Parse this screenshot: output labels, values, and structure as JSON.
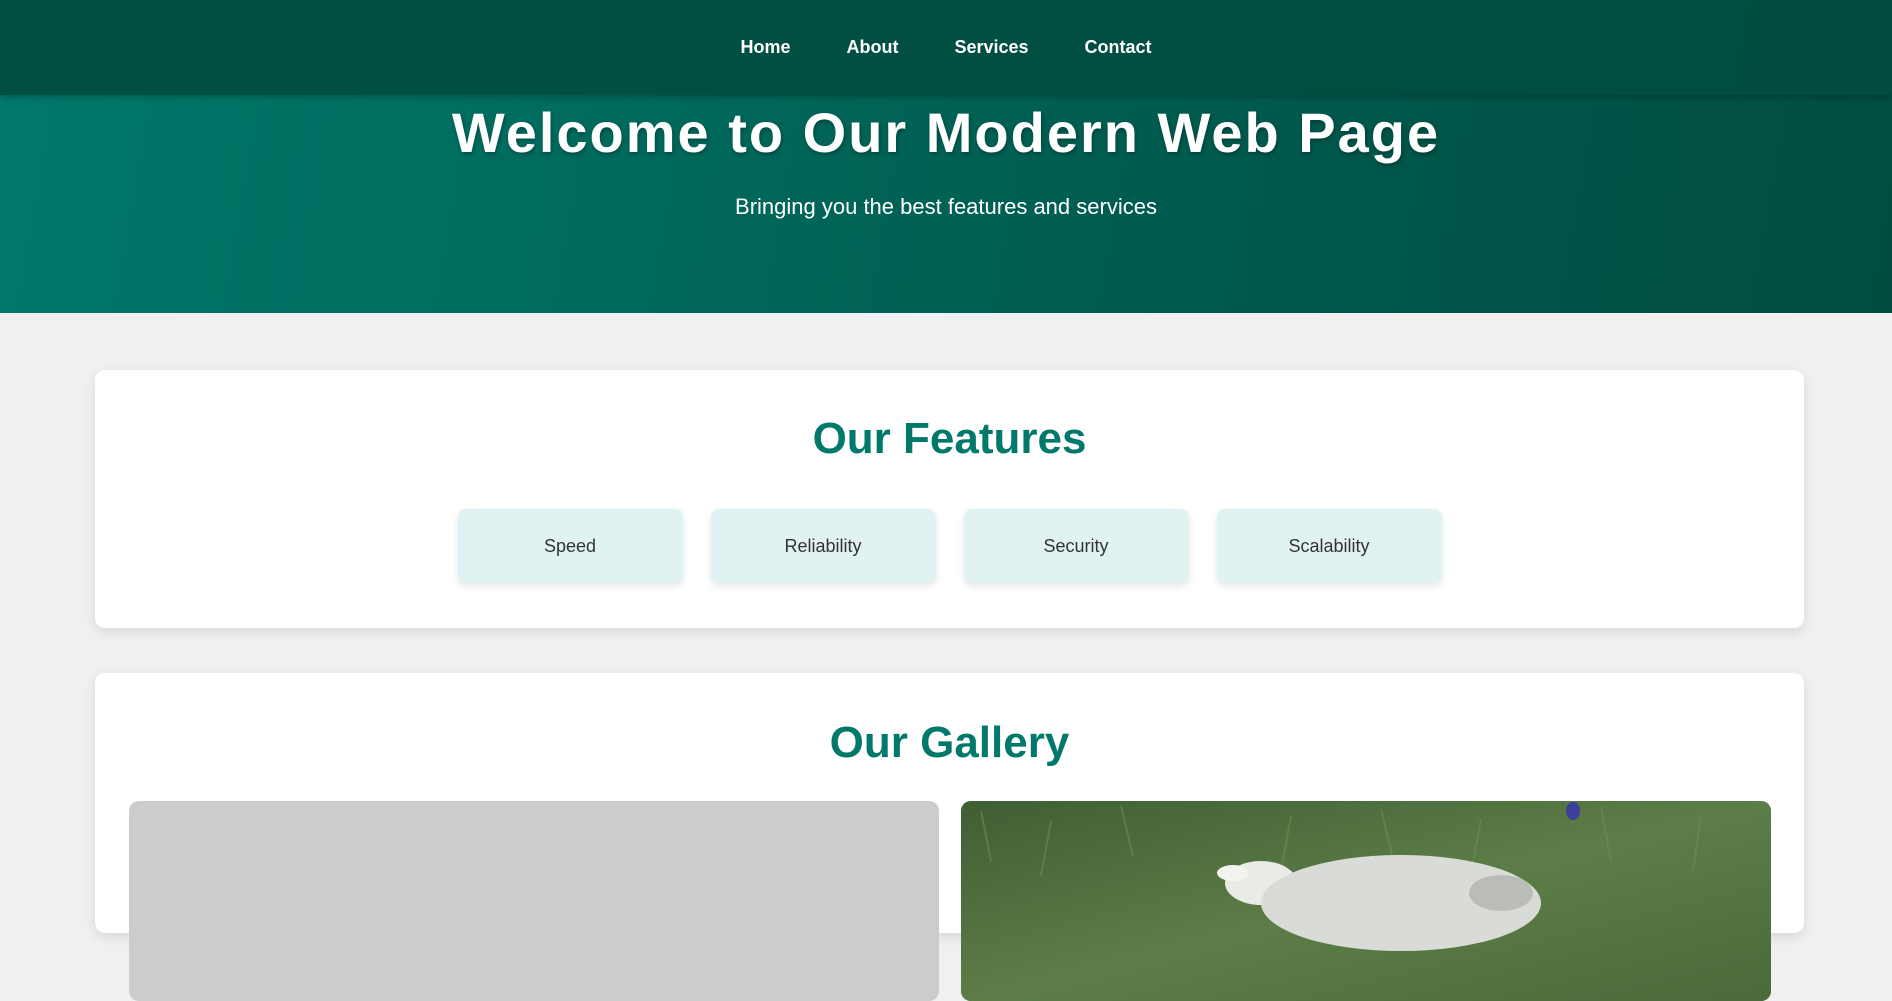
{
  "nav": {
    "items": [
      {
        "label": "Home"
      },
      {
        "label": "About"
      },
      {
        "label": "Services"
      },
      {
        "label": "Contact"
      }
    ]
  },
  "hero": {
    "title": "Welcome to Our Modern Web Page",
    "subtitle": "Bringing you the best features and services"
  },
  "features": {
    "title": "Our Features",
    "items": [
      {
        "label": "Speed"
      },
      {
        "label": "Reliability"
      },
      {
        "label": "Security"
      },
      {
        "label": "Scalability"
      }
    ]
  },
  "gallery": {
    "title": "Our Gallery",
    "images": [
      {
        "name": "gallery-image-placeholder"
      },
      {
        "name": "gallery-image-dog-on-grass"
      }
    ]
  },
  "colors": {
    "accent": "#00796b",
    "nav_bg": "#004d40",
    "feature_card_bg": "#e0f2f1",
    "page_bg": "#f0f0f0"
  }
}
